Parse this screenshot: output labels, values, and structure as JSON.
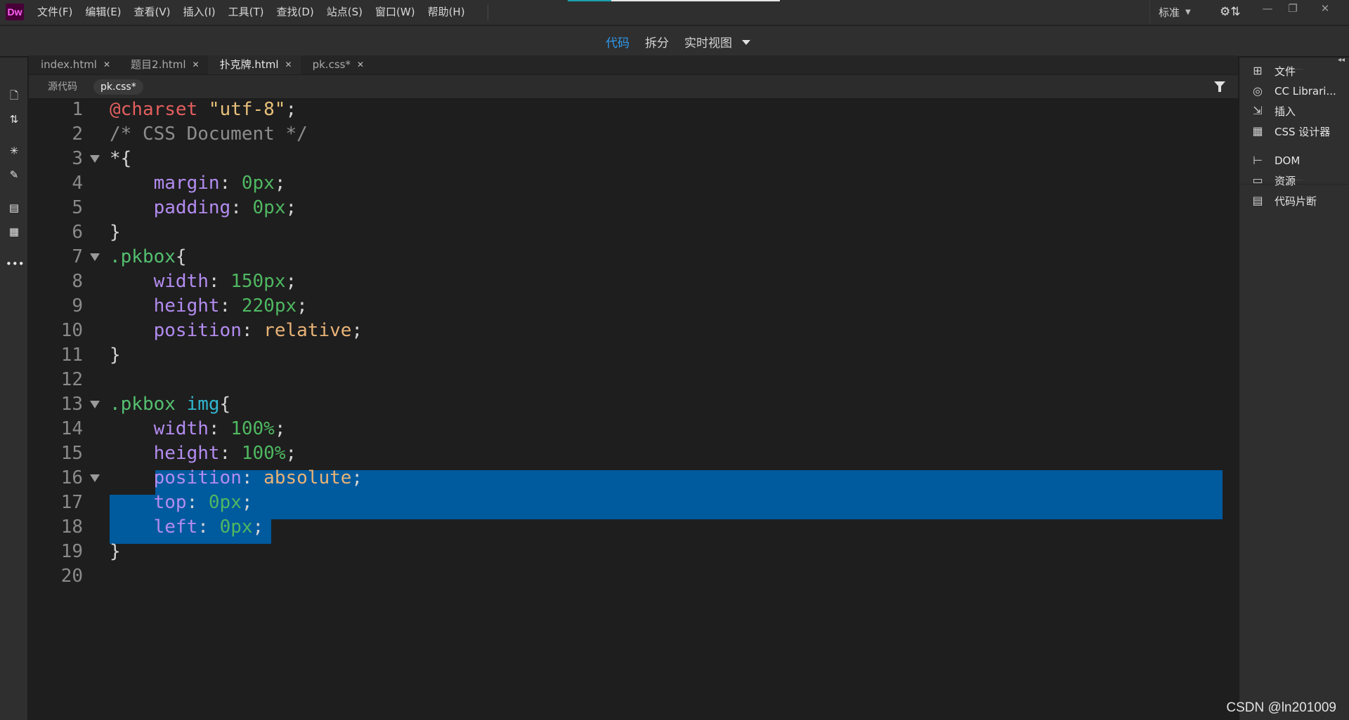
{
  "app": {
    "logo_text": "Dw"
  },
  "menu": [
    "文件(F)",
    "编辑(E)",
    "查看(V)",
    "插入(I)",
    "工具(T)",
    "查找(D)",
    "站点(S)",
    "窗口(W)",
    "帮助(H)"
  ],
  "workspace": {
    "label": "标准"
  },
  "view_switcher": {
    "tabs": [
      "代码",
      "拆分",
      "实时视图"
    ],
    "active": "代码"
  },
  "document_tabs": [
    {
      "label": "index.html",
      "active": false
    },
    {
      "label": "题目2.html",
      "active": false
    },
    {
      "label": "扑克牌.html",
      "active": true
    },
    {
      "label": "pk.css*",
      "active": false
    }
  ],
  "related_files": [
    {
      "label": "源代码",
      "active": false
    },
    {
      "label": "pk.css*",
      "active": true
    }
  ],
  "code_lines": [
    {
      "n": "1",
      "fold": false,
      "tokens": [
        {
          "t": "@charset",
          "c": "t-at"
        },
        {
          "t": " ",
          "c": "t-pun"
        },
        {
          "t": "\"utf-8\"",
          "c": "t-str"
        },
        {
          "t": ";",
          "c": "t-pun"
        }
      ]
    },
    {
      "n": "2",
      "fold": false,
      "tokens": [
        {
          "t": "/* CSS Document */",
          "c": "t-com"
        }
      ]
    },
    {
      "n": "3",
      "fold": true,
      "tokens": [
        {
          "t": "*{",
          "c": "t-pun"
        }
      ]
    },
    {
      "n": "4",
      "fold": false,
      "tokens": [
        {
          "t": "    ",
          "c": "t-pun"
        },
        {
          "t": "margin",
          "c": "t-prop"
        },
        {
          "t": ": ",
          "c": "t-pun"
        },
        {
          "t": "0px",
          "c": "t-num"
        },
        {
          "t": ";",
          "c": "t-pun"
        }
      ]
    },
    {
      "n": "5",
      "fold": false,
      "tokens": [
        {
          "t": "    ",
          "c": "t-pun"
        },
        {
          "t": "padding",
          "c": "t-prop"
        },
        {
          "t": ": ",
          "c": "t-pun"
        },
        {
          "t": "0px",
          "c": "t-num"
        },
        {
          "t": ";",
          "c": "t-pun"
        }
      ]
    },
    {
      "n": "6",
      "fold": false,
      "tokens": [
        {
          "t": "}",
          "c": "t-pun"
        }
      ]
    },
    {
      "n": "7",
      "fold": true,
      "tokens": [
        {
          "t": ".pkbox",
          "c": "t-sel"
        },
        {
          "t": "{",
          "c": "t-pun"
        }
      ]
    },
    {
      "n": "8",
      "fold": false,
      "tokens": [
        {
          "t": "    ",
          "c": "t-pun"
        },
        {
          "t": "width",
          "c": "t-prop"
        },
        {
          "t": ": ",
          "c": "t-pun"
        },
        {
          "t": "150px",
          "c": "t-num"
        },
        {
          "t": ";",
          "c": "t-pun"
        }
      ]
    },
    {
      "n": "9",
      "fold": false,
      "tokens": [
        {
          "t": "    ",
          "c": "t-pun"
        },
        {
          "t": "height",
          "c": "t-prop"
        },
        {
          "t": ": ",
          "c": "t-pun"
        },
        {
          "t": "220px",
          "c": "t-num"
        },
        {
          "t": ";",
          "c": "t-pun"
        }
      ]
    },
    {
      "n": "10",
      "fold": false,
      "tokens": [
        {
          "t": "    ",
          "c": "t-pun"
        },
        {
          "t": "position",
          "c": "t-prop"
        },
        {
          "t": ": ",
          "c": "t-pun"
        },
        {
          "t": "relative",
          "c": "t-kw"
        },
        {
          "t": ";",
          "c": "t-pun"
        }
      ]
    },
    {
      "n": "11",
      "fold": false,
      "tokens": [
        {
          "t": "}",
          "c": "t-pun"
        }
      ]
    },
    {
      "n": "12",
      "fold": false,
      "tokens": []
    },
    {
      "n": "13",
      "fold": true,
      "tokens": [
        {
          "t": ".pkbox",
          "c": "t-sel"
        },
        {
          "t": " ",
          "c": "t-pun"
        },
        {
          "t": "img",
          "c": "t-tag"
        },
        {
          "t": "{",
          "c": "t-pun"
        }
      ]
    },
    {
      "n": "14",
      "fold": false,
      "tokens": [
        {
          "t": "    ",
          "c": "t-pun"
        },
        {
          "t": "width",
          "c": "t-prop"
        },
        {
          "t": ": ",
          "c": "t-pun"
        },
        {
          "t": "100%",
          "c": "t-num"
        },
        {
          "t": ";",
          "c": "t-pun"
        }
      ]
    },
    {
      "n": "15",
      "fold": false,
      "tokens": [
        {
          "t": "    ",
          "c": "t-pun"
        },
        {
          "t": "height",
          "c": "t-prop"
        },
        {
          "t": ": ",
          "c": "t-pun"
        },
        {
          "t": "100%",
          "c": "t-num"
        },
        {
          "t": ";",
          "c": "t-pun"
        }
      ]
    },
    {
      "n": "16",
      "fold": true,
      "tokens": [
        {
          "t": "    ",
          "c": "t-pun"
        },
        {
          "t": "position",
          "c": "t-prop"
        },
        {
          "t": ": ",
          "c": "t-pun"
        },
        {
          "t": "absolute",
          "c": "t-kw"
        },
        {
          "t": ";",
          "c": "t-pun"
        }
      ]
    },
    {
      "n": "17",
      "fold": false,
      "tokens": [
        {
          "t": "    ",
          "c": "t-pun"
        },
        {
          "t": "top",
          "c": "t-prop"
        },
        {
          "t": ": ",
          "c": "t-pun"
        },
        {
          "t": "0px",
          "c": "t-num"
        },
        {
          "t": ";",
          "c": "t-pun"
        }
      ]
    },
    {
      "n": "18",
      "fold": false,
      "tokens": [
        {
          "t": "    ",
          "c": "t-pun"
        },
        {
          "t": "left",
          "c": "t-prop"
        },
        {
          "t": ": ",
          "c": "t-pun"
        },
        {
          "t": "0px",
          "c": "t-num"
        },
        {
          "t": ";",
          "c": "t-pun"
        }
      ]
    },
    {
      "n": "19",
      "fold": false,
      "tokens": [
        {
          "t": "}",
          "c": "t-pun"
        }
      ]
    },
    {
      "n": "20",
      "fold": false,
      "tokens": []
    }
  ],
  "selection": {
    "from_line": 16,
    "to_line": 18
  },
  "right_panel": {
    "items": [
      {
        "label": "文件",
        "icon": "sitemap-icon",
        "glyph": "⊞"
      },
      {
        "label": "CC Librari...",
        "icon": "creative-cloud-icon",
        "glyph": "◎"
      },
      {
        "label": "插入",
        "icon": "insert-icon",
        "glyph": "⇲"
      },
      {
        "label": "CSS 设计器",
        "icon": "css-designer-icon",
        "glyph": "▦"
      },
      {
        "label": "DOM",
        "icon": "dom-tree-icon",
        "glyph": "⊢"
      },
      {
        "label": "资源",
        "icon": "assets-icon",
        "glyph": "▭"
      },
      {
        "label": "代码片断",
        "icon": "snippets-icon",
        "glyph": "▤"
      }
    ]
  },
  "watermark": "CSDN @ln201009",
  "colors": {
    "accent_blue": "#2f9bf0",
    "selection": "#005a9e",
    "background": "#1e1e1e",
    "chrome": "#2f2f2f"
  }
}
